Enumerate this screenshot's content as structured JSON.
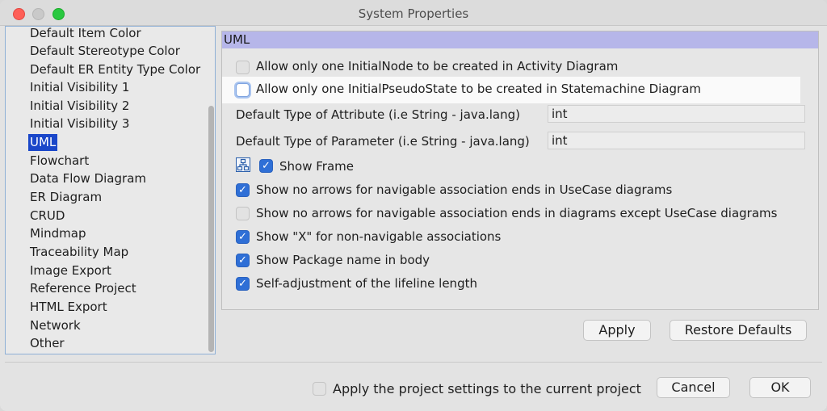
{
  "window": {
    "title": "System Properties"
  },
  "sidebar": {
    "items": [
      {
        "label": "Default Item Color"
      },
      {
        "label": "Default Stereotype Color"
      },
      {
        "label": "Default ER Entity Type Color"
      },
      {
        "label": "Initial Visibility 1"
      },
      {
        "label": "Initial Visibility 2"
      },
      {
        "label": "Initial Visibility 3"
      },
      {
        "label": "UML",
        "selected": true
      },
      {
        "label": "Flowchart"
      },
      {
        "label": "Data Flow Diagram"
      },
      {
        "label": "ER Diagram"
      },
      {
        "label": "CRUD"
      },
      {
        "label": "Mindmap"
      },
      {
        "label": "Traceability Map"
      },
      {
        "label": "Image Export"
      },
      {
        "label": "Reference Project"
      },
      {
        "label": "HTML Export"
      },
      {
        "label": "Network"
      },
      {
        "label": "Other"
      }
    ]
  },
  "panel": {
    "title": "UML",
    "options": [
      {
        "label": "Allow only one InitialNode to be created in Activity Diagram",
        "checked": false
      },
      {
        "label": "Allow only one InitialPseudoState to be created in Statemachine Diagram",
        "checked": false
      },
      {
        "label": "Show Frame",
        "checked": true
      },
      {
        "label": "Show no arrows for navigable association ends in UseCase diagrams",
        "checked": true
      },
      {
        "label": "Show no arrows for navigable association ends in diagrams except UseCase diagrams",
        "checked": false
      },
      {
        "label": "Show \"X\" for non-navigable associations",
        "checked": true
      },
      {
        "label": "Show Package name in body",
        "checked": true
      },
      {
        "label": "Self-adjustment of the lifeline length",
        "checked": true
      }
    ],
    "fields": [
      {
        "label": "Default Type of Attribute (i.e String - java.lang)",
        "value": "int"
      },
      {
        "label": "Default Type of Parameter (i.e String - java.lang)",
        "value": "int"
      }
    ],
    "frame_icon": "diagram-frame-icon",
    "apply_label": "Apply",
    "restore_label": "Restore Defaults"
  },
  "footer": {
    "apply_project_label": "Apply the project settings to the current project",
    "apply_project_checked": false,
    "cancel_label": "Cancel",
    "ok_label": "OK"
  },
  "colors": {
    "selection": "#1a47c9",
    "section_header": "#b6b6e9",
    "checkbox_on": "#2f6fd6"
  }
}
